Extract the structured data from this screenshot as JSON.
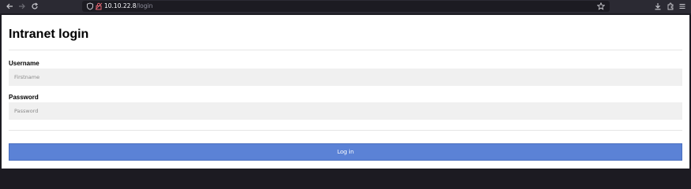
{
  "browser": {
    "url_host": "10.10.22.8",
    "url_path": "/login",
    "icons": [
      "back-icon",
      "forward-icon",
      "reload-icon",
      "shield-icon",
      "insecure-lock-icon",
      "bookmark-star-icon",
      "download-icon",
      "extensions-icon",
      "menu-icon"
    ]
  },
  "page": {
    "title": "Intranet login",
    "username_label": "Username",
    "username_placeholder": "Firstname",
    "username_value": "",
    "password_label": "Password",
    "password_placeholder": "Password",
    "password_value": "",
    "login_label": "Log in"
  },
  "colors": {
    "login_button": "#5b82d6",
    "field_background": "#f0f0f0",
    "browser_toolbar": "#2b2a33"
  }
}
